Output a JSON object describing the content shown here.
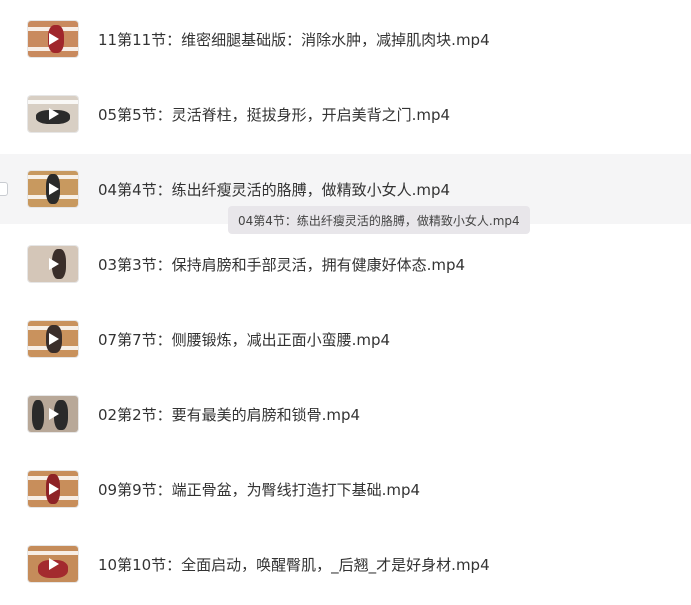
{
  "files": [
    {
      "name": "11第11节：维密细腿基础版：消除水肿，减掉肌肉块.mp4",
      "thumb_bg": "#c98a5e",
      "figure_color": "#a0262b"
    },
    {
      "name": "05第5节：灵活脊柱，挺拔身形，开启美背之门.mp4",
      "thumb_bg": "#d8cfc4",
      "figure_color": "#2b2b2b"
    },
    {
      "name": "04第4节：练出纤瘦灵活的胳膊，做精致小女人.mp4",
      "thumb_bg": "#c8995f",
      "figure_color": "#2a2a2a"
    },
    {
      "name": "03第3节：保持肩膀和手部灵活，拥有健康好体态.mp4",
      "thumb_bg": "#d4c6b8",
      "figure_color": "#3a2e2a"
    },
    {
      "name": "07第7节：侧腰锻炼，减出正面小蛮腰.mp4",
      "thumb_bg": "#c9925d",
      "figure_color": "#3a2e2a"
    },
    {
      "name": "02第2节：要有最美的肩膀和锁骨.mp4",
      "thumb_bg": "#b8a898",
      "figure_color": "#2a2a2a"
    },
    {
      "name": "09第9节：端正骨盆，为臀线打造打下基础.mp4",
      "thumb_bg": "#c88e5b",
      "figure_color": "#8e2226"
    },
    {
      "name": "10第10节：全面启动，唤醒臀肌，_后翘_才是好身材.mp4",
      "thumb_bg": "#c58c5a",
      "figure_color": "#a32a2e"
    }
  ],
  "tooltip": {
    "text": "04第4节：练出纤瘦灵活的胳膊，做精致小女人.mp4"
  },
  "icons": {
    "play": "play-icon",
    "video": "video-thumbnail"
  },
  "colors": {
    "hover_row": "#f5f5f6",
    "tooltip_bg": "#e8e6ea",
    "text": "#333333"
  }
}
